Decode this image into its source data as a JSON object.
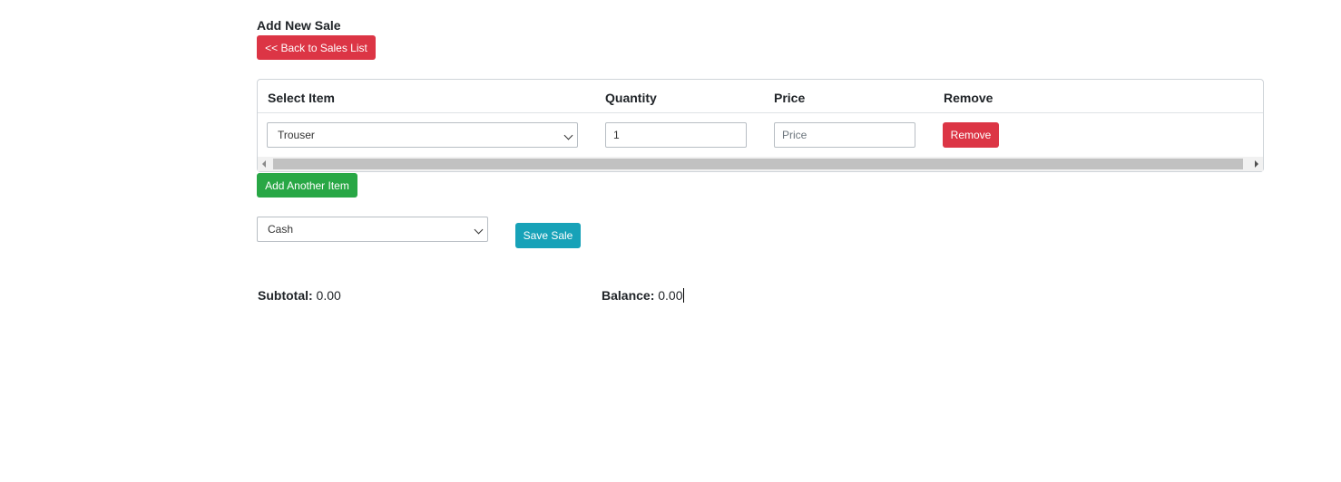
{
  "page": {
    "title": "Add New Sale",
    "back_button": "<< Back to Sales List"
  },
  "table": {
    "headers": [
      "Select Item",
      "Quantity",
      "Price",
      "Remove"
    ],
    "rows": [
      {
        "item": "Trouser",
        "quantity": "1",
        "price_placeholder": "Price",
        "remove_label": "Remove"
      }
    ]
  },
  "add_item_button": "Add Another Item",
  "payment": {
    "selected": "Cash"
  },
  "save_button": "Save Sale",
  "summary": {
    "subtotal_label": "Subtotal:",
    "subtotal_value": "0.00",
    "balance_label": "Balance:",
    "balance_value": "0.00"
  },
  "colors": {
    "danger": "#dc3545",
    "success": "#28a745",
    "info": "#17a2b8"
  }
}
